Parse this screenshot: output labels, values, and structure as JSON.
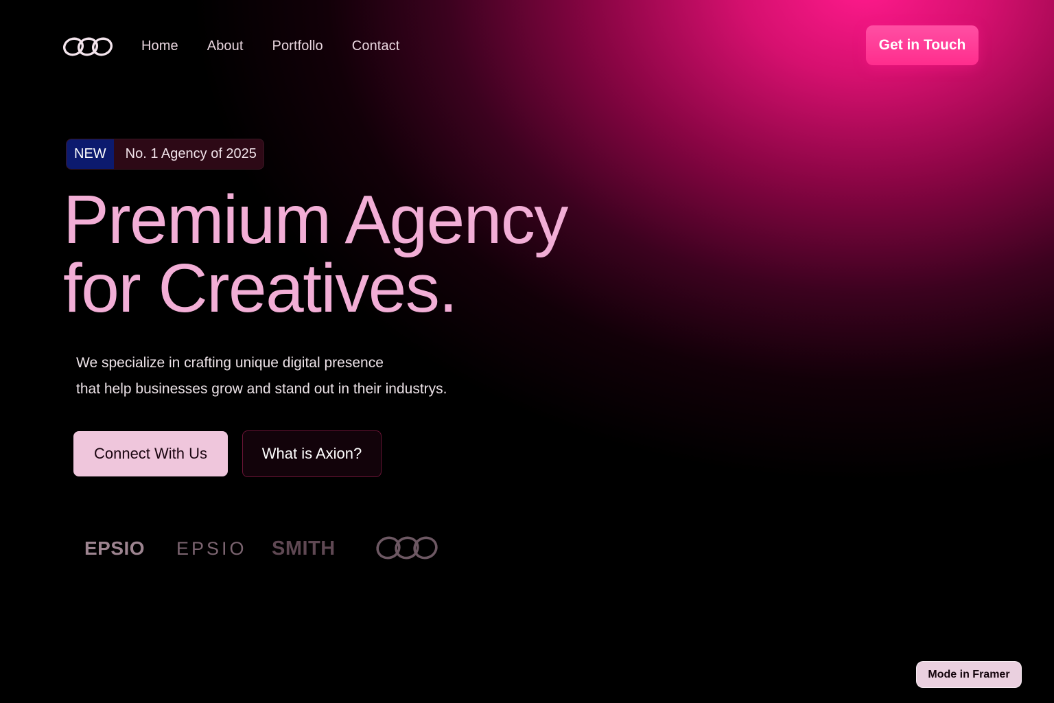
{
  "header": {
    "logo_icon": "interlocking-rings-icon",
    "nav": [
      {
        "label": "Home"
      },
      {
        "label": "About"
      },
      {
        "label": "Portfollo"
      },
      {
        "label": "Contact"
      }
    ],
    "cta_label": "Get in Touch"
  },
  "badge": {
    "tag": "NEW",
    "text": "No. 1 Agency of 2025"
  },
  "hero": {
    "title_line_1": "Premium Agency",
    "title_line_2": "for Creatives.",
    "description_line_1": "We specialize in crafting unique digital presence",
    "description_line_2": "that help businesses grow and stand out in their industrys.",
    "primary_button": "Connect With Us",
    "secondary_button": "What is Axion?"
  },
  "brands": {
    "items": [
      "EPSIO",
      "EPSIO",
      "SMITH"
    ],
    "last_logo_icon": "interlocking-rings-icon"
  },
  "framer_badge": "Mode in Framer",
  "colors": {
    "accent": "#ff2d8d",
    "title": "#f2aed6",
    "badge_tag_bg": "#0c1a6e",
    "primary_button_bg": "#efc6dc"
  }
}
